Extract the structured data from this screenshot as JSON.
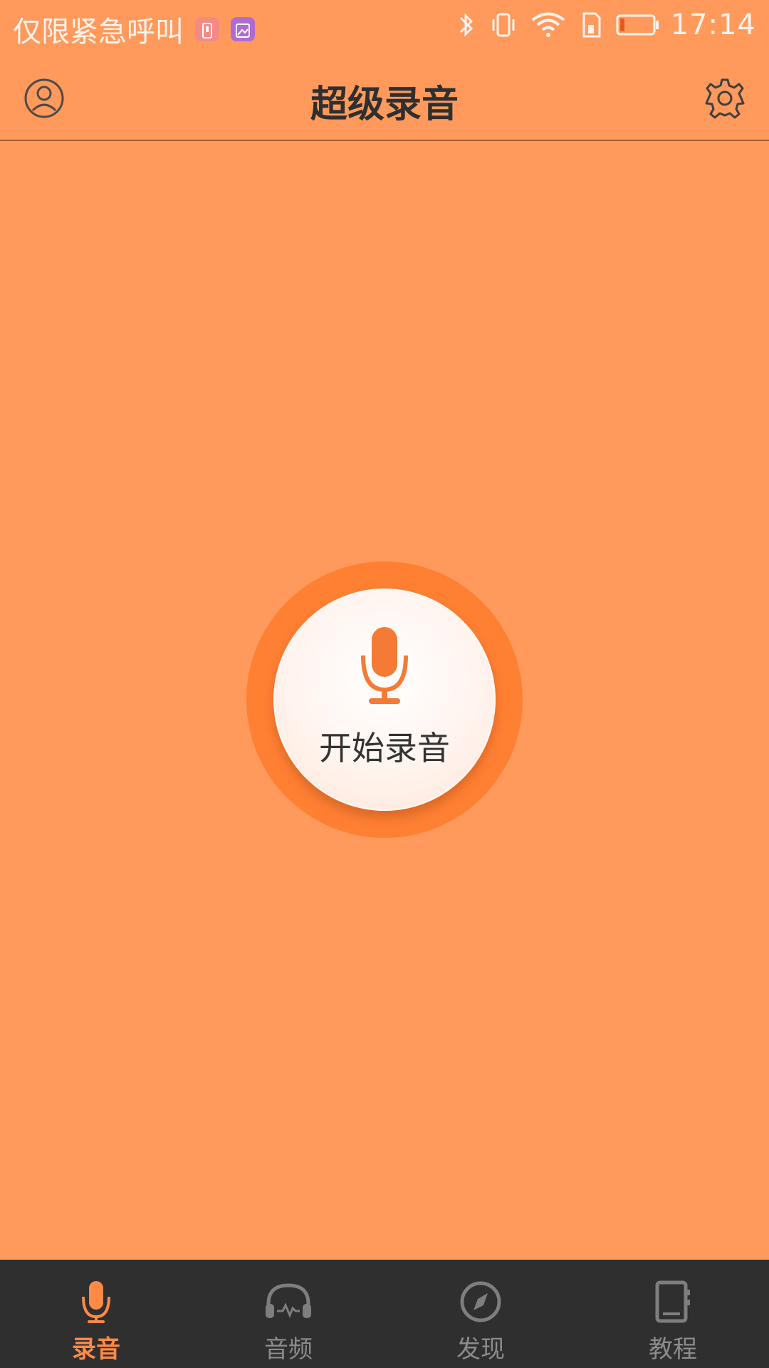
{
  "status_bar": {
    "carrier_text": "仅限紧急呼叫",
    "time": "17:14",
    "icons": [
      "battery-alert-icon",
      "image-notification-icon",
      "bluetooth-icon",
      "vibrate-icon",
      "wifi-icon",
      "sim-icon",
      "battery-icon"
    ]
  },
  "app_bar": {
    "title": "超级录音",
    "left_icon": "user-profile-icon",
    "right_icon": "gear-icon"
  },
  "record_button": {
    "label": "开始录音",
    "icon": "microphone-icon"
  },
  "tabs": [
    {
      "label": "录音",
      "icon": "microphone-icon",
      "active": true
    },
    {
      "label": "音频",
      "icon": "headphones-icon",
      "active": false
    },
    {
      "label": "发现",
      "icon": "compass-icon",
      "active": false
    },
    {
      "label": "教程",
      "icon": "notebook-icon",
      "active": false
    }
  ],
  "colors": {
    "background": "#ff9a5c",
    "accent": "#ff7f33",
    "tab_bar": "#2f2f2f",
    "tab_active": "#ff8a46",
    "tab_inactive": "#8b8b8b"
  }
}
